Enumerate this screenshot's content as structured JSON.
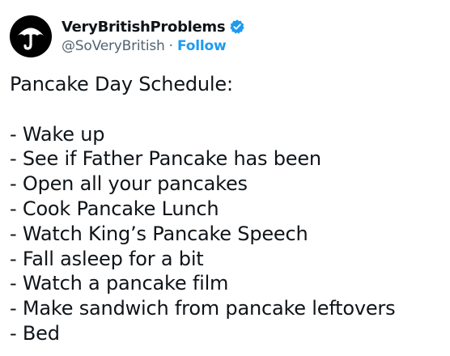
{
  "account": {
    "display_name": "VeryBritishProblems",
    "handle": "@SoVeryBritish",
    "separator": "·",
    "follow_label": "Follow",
    "verified_icon": "verified-badge-icon",
    "avatar_icon": "umbrella-icon"
  },
  "tweet": {
    "heading": "Pancake Day Schedule:",
    "items": [
      "- Wake up",
      "- See if Father Pancake has been",
      "- Open all your pancakes",
      "- Cook Pancake Lunch",
      "- Watch King’s Pancake Speech",
      "- Fall asleep for a bit",
      "- Watch a pancake film",
      "- Make sandwich from pancake leftovers",
      "- Bed"
    ]
  },
  "colors": {
    "text": "#0f1419",
    "secondary": "#536471",
    "accent": "#1d9bf0",
    "avatar_bg": "#000000"
  }
}
